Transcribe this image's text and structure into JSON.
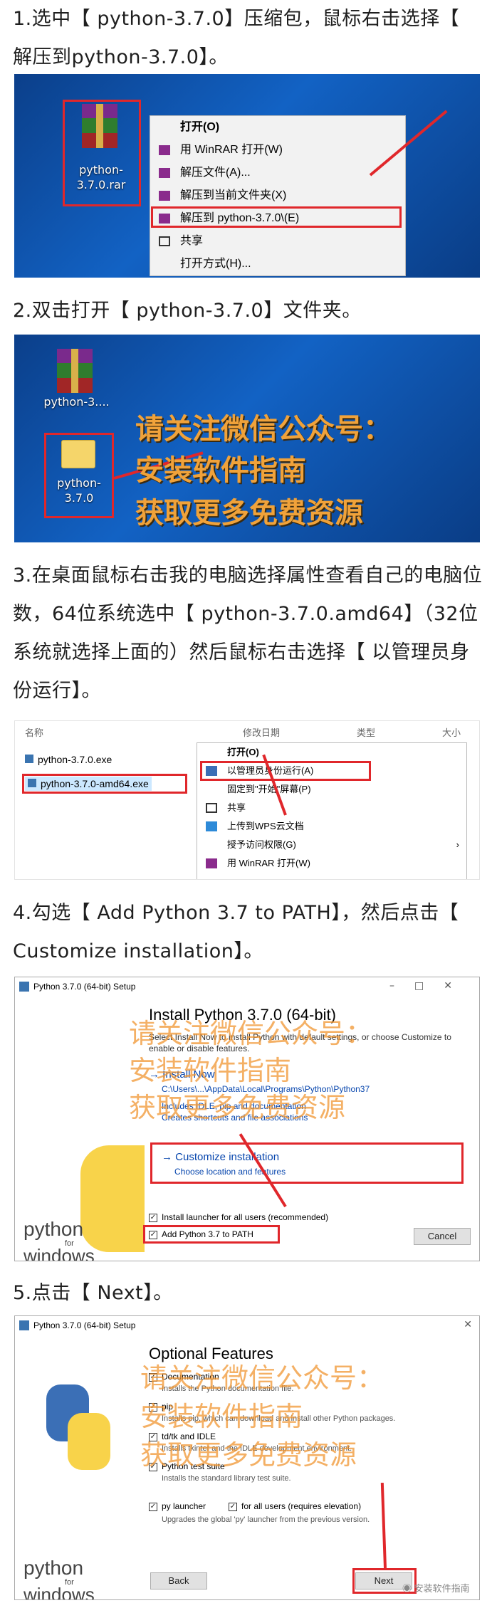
{
  "steps": {
    "s1": "1.选中【 python-3.7.0】压缩包，鼠标右击选择【 解压到python-3.7.0】。",
    "s2": "2.双击打开【 python-3.7.0】文件夹。",
    "s3": "3.在桌面鼠标右击我的电脑选择属性查看自己的电脑位数，64位系统选中【 python-3.7.0.amd64】（32位系统就选择上面的）然后鼠标右击选择【 以管理员身份运行】。",
    "s4": "4.勾选【 Add Python 3.7 to PATH】，然后点击【 Customize installation】。",
    "s5": "5.点击【 Next】。"
  },
  "shot1": {
    "file_label": "python-3.7.0.rar",
    "menu": [
      "打开(O)",
      "用 WinRAR 打开(W)",
      "解压文件(A)...",
      "解压到当前文件夹(X)",
      "解压到 python-3.7.0\\(E)",
      "共享",
      "打开方式(H)..."
    ]
  },
  "shot2": {
    "icon1_label": "python-3....",
    "icon2_label": "python-3.7.0",
    "watermark": [
      "请关注微信公众号：",
      "安装软件指南",
      "获取更多免费资源"
    ]
  },
  "shot3": {
    "col_name": "名称",
    "col_date": "修改日期",
    "col_type": "类型",
    "col_size": "大小",
    "files": [
      "python-3.7.0.exe",
      "python-3.7.0-amd64.exe"
    ],
    "menu": [
      "打开(O)",
      "以管理员身份运行(A)",
      "固定到\"开始\"屏幕(P)",
      "共享",
      "上传到WPS云文档",
      "授予访问权限(G)",
      "用 WinRAR 打开(W)"
    ]
  },
  "shot4": {
    "window_title": "Python 3.7.0 (64-bit) Setup",
    "heading": "Install Python 3.7.0 (64-bit)",
    "intro": "Select Install Now to install Python with default settings, or choose Customize to enable or disable features.",
    "install_now": "Install Now",
    "install_path": "C:\\Users\\...\\AppData\\Local\\Programs\\Python\\Python37",
    "includes": "Includes IDLE, pip and documentation",
    "shortcuts": "Creates shortcuts and file associations",
    "customize": "Customize installation",
    "customize_sub": "Choose location and features",
    "launcher": "Install launcher for all users (recommended)",
    "add_path": "Add Python 3.7 to PATH",
    "cancel": "Cancel",
    "logo_python": "python",
    "logo_for": "for",
    "logo_windows": "windows",
    "watermark": [
      "请关注微信公众号：",
      "安装软件指南",
      "获取更多免费资源"
    ]
  },
  "shot5": {
    "window_title": "Python 3.7.0 (64-bit) Setup",
    "heading": "Optional Features",
    "options": [
      {
        "label": "Documentation",
        "desc": "Installs the Python documentation file."
      },
      {
        "label": "pip",
        "desc": "Installs pip, which can download and install other Python packages."
      },
      {
        "label": "td/tk and IDLE",
        "desc": "Installs tkinter and the IDLE development environment."
      },
      {
        "label": "Python test suite",
        "desc": "Installs the standard library test suite."
      }
    ],
    "py_launcher": "py launcher",
    "all_users": "for all users (requires elevation)",
    "launcher_desc": "Upgrades the global 'py' launcher from the previous version.",
    "back": "Back",
    "next": "Next",
    "logo_python": "python",
    "logo_for": "for",
    "logo_windows": "windows",
    "footer_watermark": "安装软件指南",
    "watermark": [
      "请关注微信公众号：",
      "安装软件指南",
      "获取更多免费资源"
    ]
  },
  "colors": {
    "highlight": "#e0272b",
    "watermark": "#f0a23a",
    "desktop": "#1262c4"
  }
}
